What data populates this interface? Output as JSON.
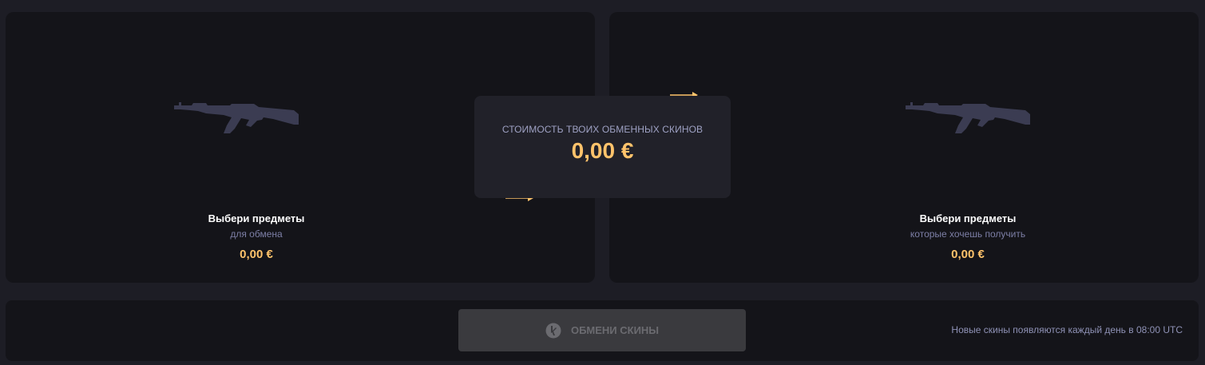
{
  "left_panel": {
    "title": "Выбери предметы",
    "subtitle": "для обмена",
    "price": "0,00 €",
    "icon": "rifle-placeholder-icon"
  },
  "right_panel": {
    "title": "Выбери предметы",
    "subtitle": "которые хочешь получить",
    "price": "0,00 €",
    "icon": "rifle-placeholder-icon"
  },
  "center": {
    "label": "СТОИМОСТЬ ТВОИХ ОБМЕННЫХ СКИНОВ",
    "value": "0,00 €"
  },
  "bottom": {
    "exchange_button_label": "ОБМЕНИ СКИНЫ",
    "exchange_icon": "exchange-coin-icon",
    "notice": "Новые скины появляются каждый день в 08:00 UTC"
  },
  "colors": {
    "background": "#1d1d25",
    "panel": "#141419",
    "center_box": "#212129",
    "accent": "#ffc36b",
    "muted": "#7d7fa6",
    "rifle_silhouette": "#3b3c52",
    "button_disabled": "#3a3a3e"
  }
}
